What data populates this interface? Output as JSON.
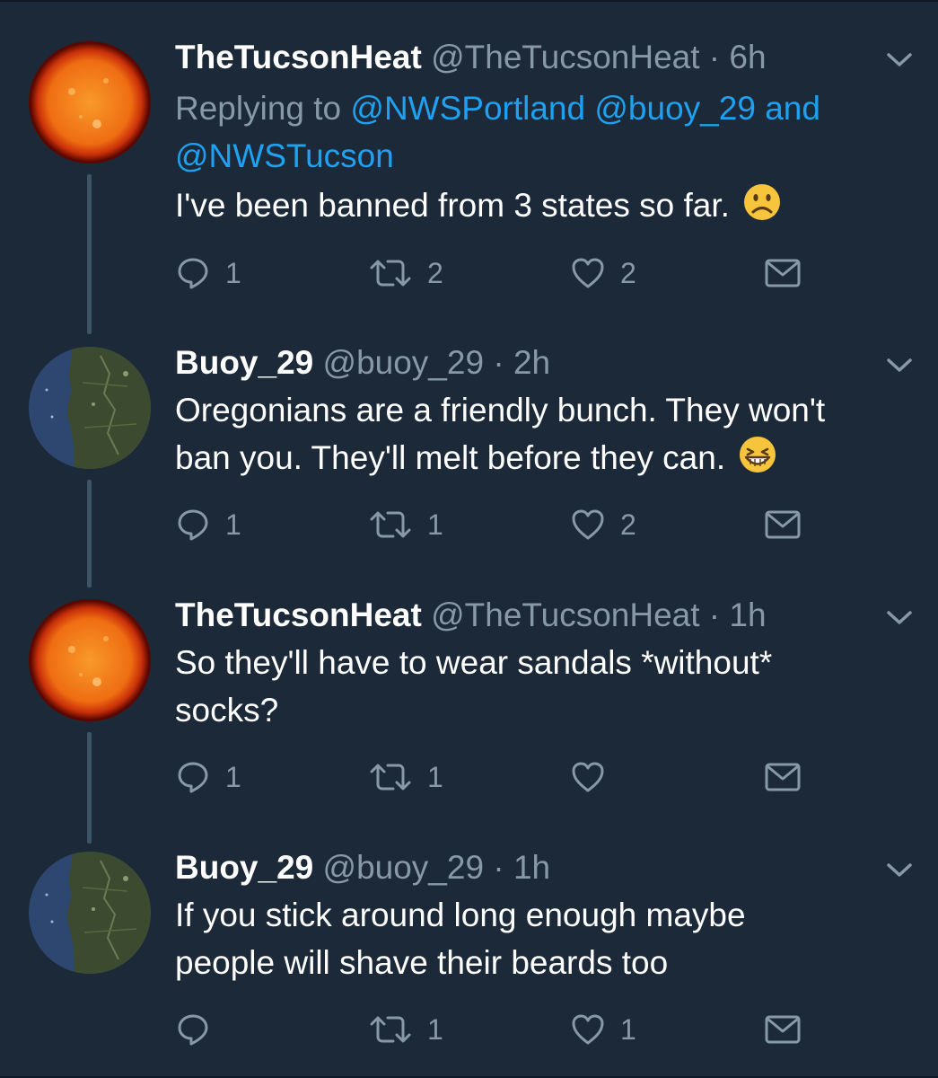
{
  "tweets": [
    {
      "name": "TheTucsonHeat",
      "handle": "@TheTucsonHeat",
      "separator": "·",
      "time": "6h",
      "avatar": "sun-avatar",
      "reply_prefix": "Replying to",
      "reply_mention_1": "@NWSPortland",
      "reply_mention_2": "@buoy_29",
      "reply_and": "and",
      "reply_mention_3": "@NWSTucson",
      "text_line_1": "I've been banned from 3 states so far.",
      "text_line_2": "",
      "emoji": "frowning-face-emoji",
      "replies": "1",
      "retweets": "2",
      "likes": "2"
    },
    {
      "name": "Buoy_29",
      "handle": "@buoy_29",
      "separator": "·",
      "time": "2h",
      "avatar": "satellite-map-avatar",
      "text_line_1": "Oregonians are a friendly bunch. They won't",
      "text_line_2": "ban you. They'll melt before they can.",
      "emoji": "grinning-squinting-face-emoji",
      "replies": "1",
      "retweets": "1",
      "likes": "2"
    },
    {
      "name": "TheTucsonHeat",
      "handle": "@TheTucsonHeat",
      "separator": "·",
      "time": "1h",
      "avatar": "sun-avatar",
      "text_line_1": "So they'll have to wear sandals *without*",
      "text_line_2": "socks?",
      "replies": "1",
      "retweets": "1",
      "likes": ""
    },
    {
      "name": "Buoy_29",
      "handle": "@buoy_29",
      "separator": "·",
      "time": "1h",
      "avatar": "satellite-map-avatar",
      "text_line_1": "If you stick around long enough maybe",
      "text_line_2": "people will shave their beards too",
      "replies": "",
      "retweets": "1",
      "likes": "1"
    }
  ],
  "colors": {
    "background": "#1c2938",
    "name": "#ffffff",
    "secondary": "#8899a6",
    "link": "#1da1f2",
    "thread_line": "#3d5466"
  }
}
